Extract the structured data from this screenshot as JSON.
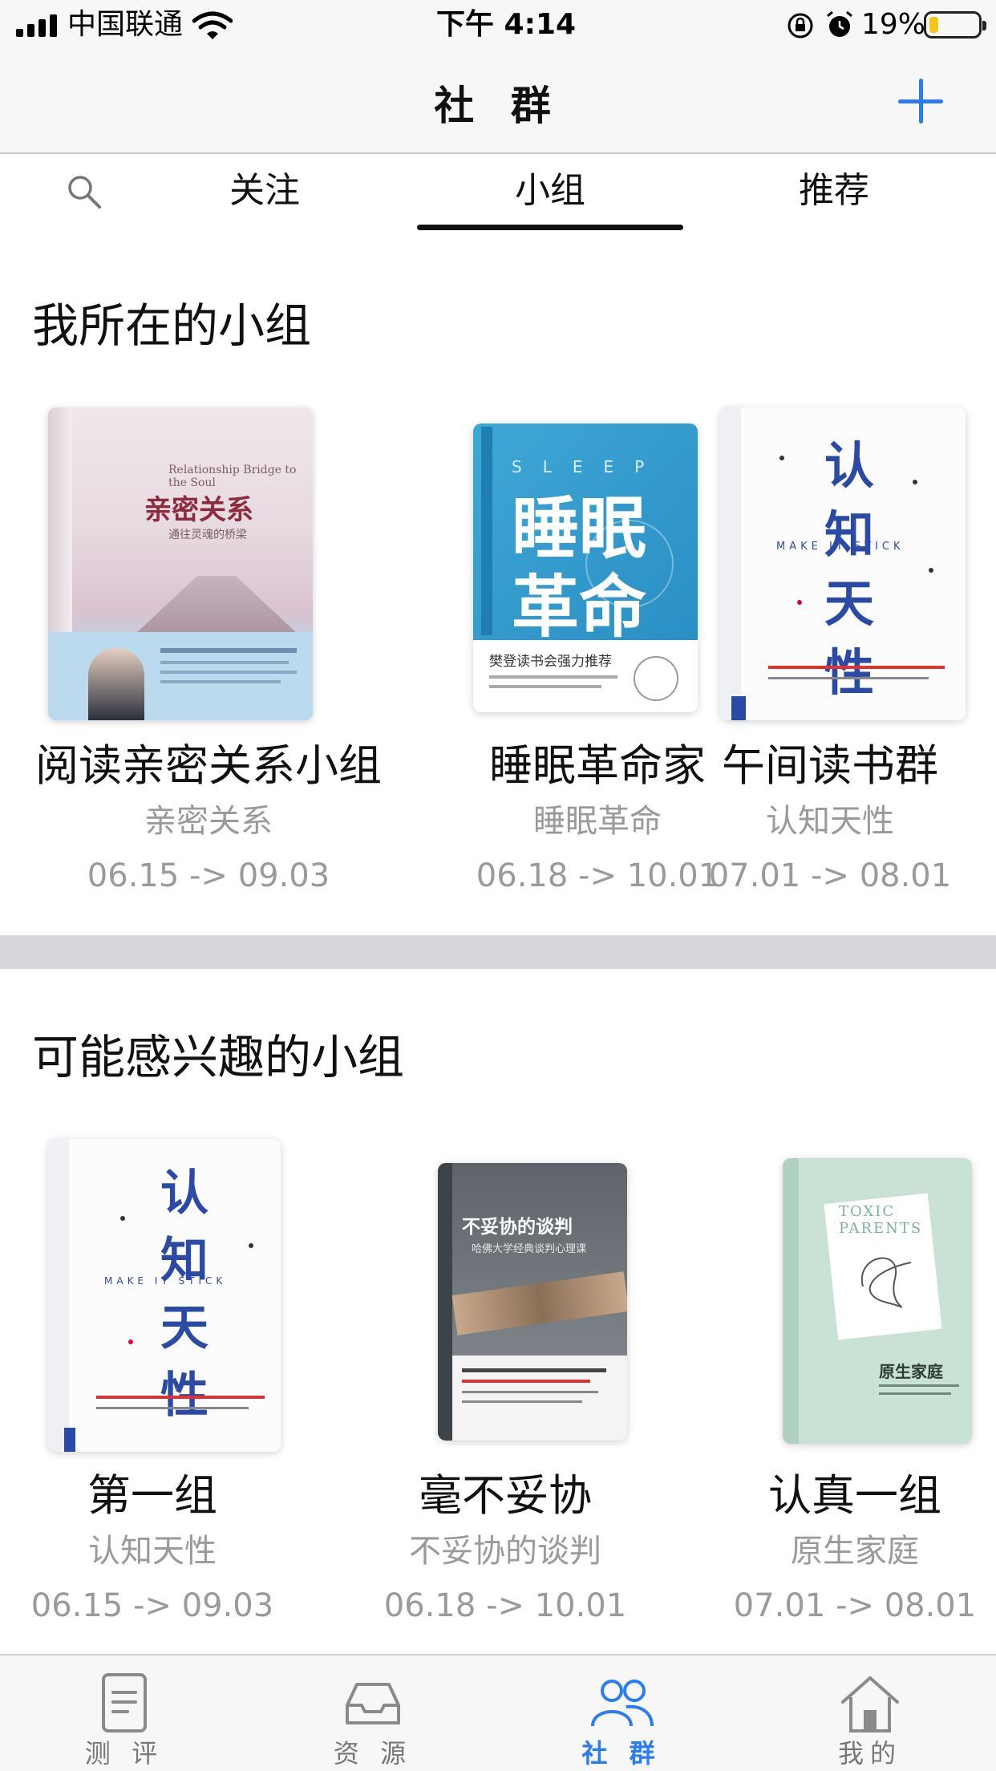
{
  "status_bar": {
    "carrier": "中国联通",
    "time": "下午 4:14",
    "battery_percent": "19%",
    "battery_level": 0.19,
    "battery_color": "#f5c518"
  },
  "nav": {
    "title": "社 群",
    "add_icon": "plus-icon",
    "accent_color": "#2a7df0"
  },
  "tabs": {
    "search_icon": "search-icon",
    "items": [
      {
        "label": "关注",
        "active": false
      },
      {
        "label": "小组",
        "active": true
      },
      {
        "label": "推荐",
        "active": false
      }
    ]
  },
  "my_groups": {
    "title": "我所在的小组",
    "items": [
      {
        "name": "阅读亲密关系小组",
        "book": "亲密关系",
        "dates": "06.15 -> 09.03",
        "cover": {
          "main_title": "亲密关系",
          "sub_title": "Relationship Bridge to the Soul",
          "subtitle_cn": "通往灵魂的桥梁"
        }
      },
      {
        "name": "睡眠革命家",
        "book": "睡眠革命",
        "dates": "06.18 -> 10.01",
        "cover": {
          "main_title": "睡眠革命",
          "sub_title": "SLEEP",
          "banner": "樊登读书会强力推荐"
        }
      },
      {
        "name": "午间读书群",
        "book": "认知天性",
        "dates": "07.01 -> 08.01",
        "cover": {
          "main_title": "认知天性",
          "sub_title": "MAKE IT STICK"
        }
      }
    ]
  },
  "interest_groups": {
    "title": "可能感兴趣的小组",
    "items": [
      {
        "name": "第一组",
        "book": "认知天性",
        "dates": "06.15 -> 09.03",
        "cover": {
          "main_title": "认知天性",
          "sub_title": "MAKE IT STICK"
        }
      },
      {
        "name": "毫不妥协",
        "book": "不妥协的谈判",
        "dates": "06.18 -> 10.01",
        "cover": {
          "main_title": "不妥协的谈判",
          "sub_title": "哈佛大学经典谈判心理课"
        }
      },
      {
        "name": "认真一组",
        "book": "原生家庭",
        "dates": "07.01 -> 08.01",
        "cover": {
          "main_title": "原生家庭",
          "sub_title": "TOXIC PARENTS"
        }
      }
    ]
  },
  "tab_bar": {
    "items": [
      {
        "label": "测 评",
        "icon": "document-icon",
        "active": false
      },
      {
        "label": "资 源",
        "icon": "inbox-icon",
        "active": false
      },
      {
        "label": "社 群",
        "icon": "people-icon",
        "active": true
      },
      {
        "label": "我的",
        "icon": "home-icon",
        "active": false
      }
    ]
  }
}
